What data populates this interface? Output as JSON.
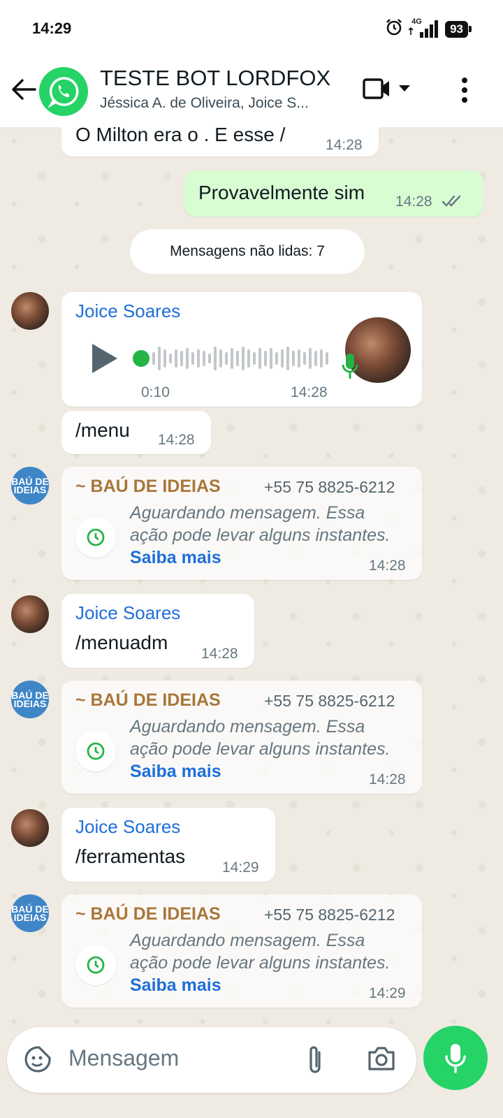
{
  "status_bar": {
    "time": "14:29",
    "network": "4G",
    "battery": "93"
  },
  "header": {
    "title": "TESTE BOT LORDFOX",
    "subtitle": "Jéssica A. de Oliveira, Joice S..."
  },
  "messages": {
    "m1": {
      "text": "O Milton era o . E esse /",
      "time": "14:28"
    },
    "m2": {
      "text": "Provavelmente sim",
      "time": "14:28"
    },
    "unread": "Mensagens não lidas: 7",
    "voice": {
      "sender": "Joice Soares",
      "duration": "0:10",
      "time": "14:28"
    },
    "m3": {
      "text": "/menu",
      "time": "14:28"
    },
    "bau1": {
      "sender": "~ BAÚ DE IDEIAS",
      "phone": "+55 75 8825-6212",
      "line1": "Aguardando mensagem. Essa",
      "line2": "ação pode levar alguns instantes.",
      "link": "Saiba mais",
      "time": "14:28"
    },
    "m4": {
      "sender": "Joice Soares",
      "text": "/menuadm",
      "time": "14:28"
    },
    "bau2": {
      "sender": "~ BAÚ DE IDEIAS",
      "phone": "+55 75 8825-6212",
      "line1": "Aguardando mensagem. Essa",
      "line2": "ação pode levar alguns instantes.",
      "link": "Saiba mais",
      "time": "14:28"
    },
    "m5": {
      "sender": "Joice Soares",
      "text": "/ferramentas",
      "time": "14:29"
    },
    "bau3": {
      "sender": "~ BAÚ DE IDEIAS",
      "phone": "+55 75 8825-6212",
      "line1": "Aguardando mensagem. Essa",
      "line2": "ação pode levar alguns instantes.",
      "link": "Saiba mais",
      "time": "14:29"
    }
  },
  "bau_avatar_text": "BAÚ DE IDEIAS",
  "input": {
    "placeholder": "Mensagem"
  },
  "icons": {
    "back": "arrow-left-icon",
    "group": "whatsapp-icon",
    "video": "video-camera-icon",
    "more": "more-vertical-icon",
    "emoji": "sticker-icon",
    "attach": "paperclip-icon",
    "camera": "camera-icon",
    "mic": "microphone-icon",
    "clock": "clock-icon",
    "play": "play-icon"
  },
  "colors": {
    "accent": "#25d366",
    "outgoing_bubble": "#d9fdd3",
    "sender_blue": "#1e6fd9",
    "bau_gold": "#a8773a",
    "chat_bg": "#efeae2"
  }
}
